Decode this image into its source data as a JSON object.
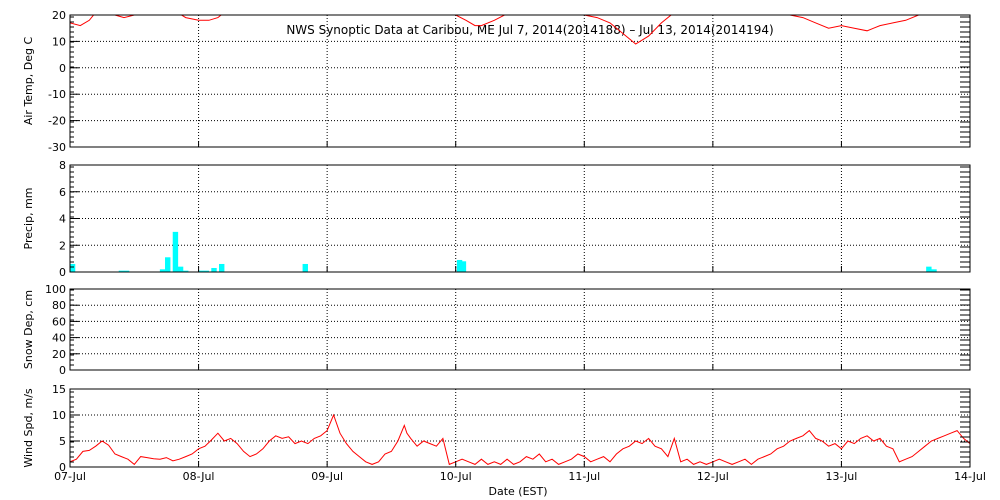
{
  "chart_data": {
    "title": "NWS Synoptic Data at Caribou, ME   Jul  7, 2014(2014188) – Jul 13, 2014(2014194)",
    "xlabel": "Date (EST)",
    "x_ticks": [
      "07-Jul",
      "08-Jul",
      "09-Jul",
      "10-Jul",
      "11-Jul",
      "12-Jul",
      "13-Jul",
      "14-Jul"
    ],
    "xlim": [
      0,
      7
    ],
    "grid": true,
    "panels": [
      {
        "id": "temp",
        "type": "line",
        "ylabel": "Air Temp, Deg C",
        "ylim": [
          -30,
          20
        ],
        "y_ticks": [
          20,
          10,
          0,
          -10,
          -20,
          -30
        ],
        "color": "#ff0000",
        "x": [
          0.0,
          0.08,
          0.15,
          0.2,
          0.25,
          0.3,
          0.35,
          0.42,
          0.5,
          0.58,
          0.62,
          0.7,
          0.8,
          0.9,
          1.0,
          1.08,
          1.15,
          1.2,
          1.28,
          1.35,
          1.42,
          1.5,
          1.58,
          1.66,
          1.75,
          1.85,
          1.95,
          2.05,
          2.15,
          2.25,
          2.35,
          2.45,
          2.55,
          2.62,
          2.7,
          2.8,
          2.9,
          3.0,
          3.08,
          3.15,
          3.2,
          3.3,
          3.42,
          3.5,
          3.6,
          3.7,
          3.8,
          3.9,
          4.0,
          4.1,
          4.2,
          4.3,
          4.35,
          4.4,
          4.5,
          4.6,
          4.7,
          4.8,
          4.9,
          5.0,
          5.1,
          5.2,
          5.3,
          5.4,
          5.5,
          5.6,
          5.7,
          5.8,
          5.9,
          6.0,
          6.1,
          6.2,
          6.25,
          6.3,
          6.4,
          6.5,
          6.6,
          6.7,
          6.8,
          6.9,
          7.0
        ],
        "y": [
          17,
          16,
          18,
          21,
          24,
          22,
          20,
          19,
          20,
          21,
          22,
          24,
          22,
          19,
          18,
          18,
          19,
          21,
          24,
          27,
          29,
          28,
          26,
          28,
          30,
          30,
          29,
          28,
          27,
          26,
          25,
          26,
          27,
          28,
          26,
          24,
          22,
          20,
          18,
          16,
          16,
          18,
          21,
          24,
          26,
          27,
          25,
          22,
          20,
          19,
          17,
          13,
          11,
          9,
          12,
          17,
          21,
          25,
          27,
          26,
          28,
          27,
          25,
          23,
          22,
          20,
          19,
          17,
          15,
          16,
          15,
          14,
          15,
          16,
          17,
          18,
          20,
          21,
          22,
          21,
          22
        ]
      },
      {
        "id": "precip",
        "type": "bar",
        "ylabel": "Precip, mm",
        "ylim": [
          0,
          8
        ],
        "y_ticks": [
          8,
          6,
          4,
          2,
          0
        ],
        "color": "#00ffff",
        "bar_width": 0.042,
        "x": [
          0.02,
          0.4,
          0.44,
          0.72,
          0.76,
          0.82,
          0.86,
          0.9,
          1.02,
          1.06,
          1.12,
          1.18,
          1.83,
          3.03,
          3.06,
          6.68,
          6.72
        ],
        "values": [
          0.6,
          0.1,
          0.1,
          0.2,
          1.1,
          3.0,
          0.4,
          0.1,
          0.1,
          0.1,
          0.3,
          0.6,
          0.6,
          0.9,
          0.8,
          0.4,
          0.2
        ]
      },
      {
        "id": "snow",
        "type": "line",
        "ylabel": "Snow Dep, cm",
        "ylim": [
          0,
          100
        ],
        "y_ticks": [
          100,
          80,
          60,
          40,
          20,
          0
        ],
        "color": "#ff0000",
        "x": [],
        "y": []
      },
      {
        "id": "wind",
        "type": "line",
        "ylabel": "Wind Spd, m/s",
        "ylim": [
          0,
          15
        ],
        "y_ticks": [
          15,
          10,
          5,
          0
        ],
        "color": "#ff0000",
        "x": [
          0.0,
          0.05,
          0.1,
          0.15,
          0.2,
          0.25,
          0.3,
          0.35,
          0.4,
          0.45,
          0.5,
          0.55,
          0.6,
          0.65,
          0.7,
          0.75,
          0.8,
          0.85,
          0.9,
          0.95,
          1.0,
          1.05,
          1.1,
          1.15,
          1.2,
          1.25,
          1.3,
          1.35,
          1.4,
          1.45,
          1.5,
          1.55,
          1.6,
          1.65,
          1.7,
          1.75,
          1.8,
          1.85,
          1.9,
          1.95,
          2.0,
          2.05,
          2.1,
          2.15,
          2.2,
          2.25,
          2.3,
          2.35,
          2.4,
          2.45,
          2.5,
          2.55,
          2.6,
          2.62,
          2.65,
          2.7,
          2.75,
          2.8,
          2.85,
          2.9,
          2.95,
          3.0,
          3.05,
          3.1,
          3.15,
          3.2,
          3.25,
          3.3,
          3.35,
          3.4,
          3.45,
          3.5,
          3.55,
          3.6,
          3.65,
          3.7,
          3.75,
          3.8,
          3.85,
          3.9,
          3.95,
          4.0,
          4.05,
          4.1,
          4.15,
          4.2,
          4.25,
          4.3,
          4.35,
          4.4,
          4.45,
          4.5,
          4.55,
          4.6,
          4.65,
          4.7,
          4.75,
          4.8,
          4.85,
          4.9,
          4.95,
          5.0,
          5.05,
          5.1,
          5.15,
          5.2,
          5.25,
          5.3,
          5.35,
          5.4,
          5.45,
          5.5,
          5.55,
          5.6,
          5.65,
          5.7,
          5.75,
          5.8,
          5.85,
          5.9,
          5.95,
          6.0,
          6.05,
          6.1,
          6.15,
          6.2,
          6.25,
          6.3,
          6.35,
          6.4,
          6.45,
          6.5,
          6.55,
          6.6,
          6.65,
          6.7,
          6.75,
          6.8,
          6.85,
          6.9,
          6.95,
          7.0
        ],
        "y": [
          1.0,
          1.5,
          3.0,
          3.2,
          4.0,
          5.0,
          4.2,
          2.5,
          2.0,
          1.5,
          0.5,
          2.0,
          1.8,
          1.6,
          1.5,
          1.8,
          1.2,
          1.5,
          2.0,
          2.5,
          3.5,
          4.0,
          5.2,
          6.5,
          5.0,
          5.5,
          4.5,
          3.0,
          2.0,
          2.5,
          3.5,
          5.0,
          6.0,
          5.5,
          5.8,
          4.5,
          5.0,
          4.5,
          5.5,
          6.0,
          7.0,
          10.0,
          6.5,
          4.5,
          3.0,
          2.0,
          1.0,
          0.5,
          1.0,
          2.5,
          3.0,
          5.0,
          8.0,
          6.5,
          5.5,
          4.0,
          5.0,
          4.5,
          4.0,
          5.5,
          0.5,
          1.0,
          1.5,
          1.0,
          0.5,
          1.5,
          0.5,
          1.0,
          0.5,
          1.5,
          0.5,
          1.0,
          2.0,
          1.5,
          2.5,
          1.0,
          1.5,
          0.5,
          1.0,
          1.5,
          2.5,
          2.0,
          1.0,
          1.5,
          2.0,
          1.0,
          2.5,
          3.5,
          4.0,
          5.0,
          4.5,
          5.5,
          4.0,
          3.5,
          2.0,
          5.5,
          1.0,
          1.5,
          0.5,
          1.0,
          0.5,
          1.0,
          1.5,
          1.0,
          0.5,
          1.0,
          1.5,
          0.5,
          1.5,
          2.0,
          2.5,
          3.5,
          4.0,
          5.0,
          5.5,
          6.0,
          7.0,
          5.5,
          5.0,
          4.0,
          4.5,
          3.5,
          5.0,
          4.5,
          5.5,
          6.0,
          5.0,
          5.5,
          4.0,
          3.5,
          1.0,
          1.5,
          2.0,
          3.0,
          4.0,
          5.0,
          5.5,
          6.0,
          6.5,
          7.0,
          5.5,
          4.5,
          5.0,
          5.5
        ]
      }
    ]
  }
}
